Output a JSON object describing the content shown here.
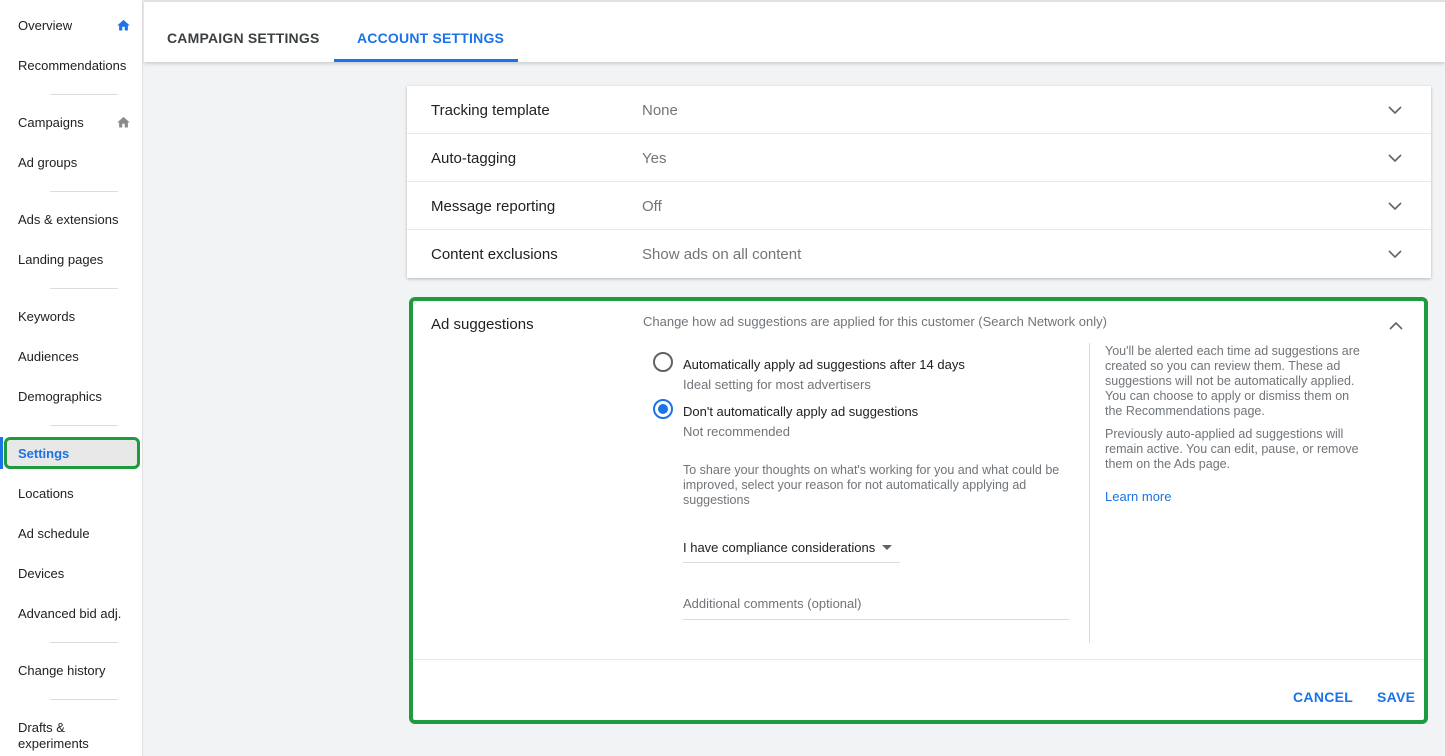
{
  "sidebar": {
    "items": [
      {
        "label": "Overview"
      },
      {
        "label": "Recommendations"
      },
      {
        "label": "Campaigns"
      },
      {
        "label": "Ad groups"
      },
      {
        "label": "Ads & extensions"
      },
      {
        "label": "Landing pages"
      },
      {
        "label": "Keywords"
      },
      {
        "label": "Audiences"
      },
      {
        "label": "Demographics"
      },
      {
        "label": "Settings"
      },
      {
        "label": "Locations"
      },
      {
        "label": "Ad schedule"
      },
      {
        "label": "Devices"
      },
      {
        "label": "Advanced bid adj."
      },
      {
        "label": "Change history"
      },
      {
        "label": "Drafts &"
      },
      {
        "label": "experiments"
      }
    ],
    "active_item": "Settings",
    "colors": {
      "home_icon_overview": "#1a73e8",
      "home_icon_campaigns": "#8a8a8a",
      "highlight": "#1e9b3e"
    }
  },
  "tabs": [
    {
      "label": "CAMPAIGN SETTINGS"
    },
    {
      "label": "ACCOUNT SETTINGS"
    }
  ],
  "active_tab": "ACCOUNT SETTINGS",
  "settings": [
    {
      "label": "Tracking template",
      "value": "None"
    },
    {
      "label": "Auto-tagging",
      "value": "Yes"
    },
    {
      "label": "Message reporting",
      "value": "Off"
    },
    {
      "label": "Content exclusions",
      "value": "Show ads on all content"
    }
  ],
  "ad_suggestions": {
    "title": "Ad suggestions",
    "description": "Change how ad suggestions are applied for this customer (Search Network only)",
    "options": [
      {
        "label": "Automatically apply ad suggestions after 14 days",
        "sub": "Ideal setting for most advertisers"
      },
      {
        "label": "Don't automatically apply ad suggestions",
        "sub": "Not recommended"
      }
    ],
    "selected_option": "Don't automatically apply ad suggestions",
    "share_text": "To share your thoughts on what's working for you and what could be improved, select your reason for not automatically applying ad suggestions",
    "reason_select": "I have compliance considerations",
    "comments_placeholder": "Additional comments (optional)",
    "help_1": "You'll be alerted each time ad suggestions are created so you can review them. These ad suggestions will not be automatically applied. You can choose to apply or dismiss them on the Recommendations page.",
    "help_2": "Previously auto-applied ad suggestions will remain active. You can edit, pause, or remove them on the Ads page.",
    "learn_more": "Learn more",
    "cancel": "CANCEL",
    "save": "SAVE"
  },
  "accent_color": "#1a73e8"
}
